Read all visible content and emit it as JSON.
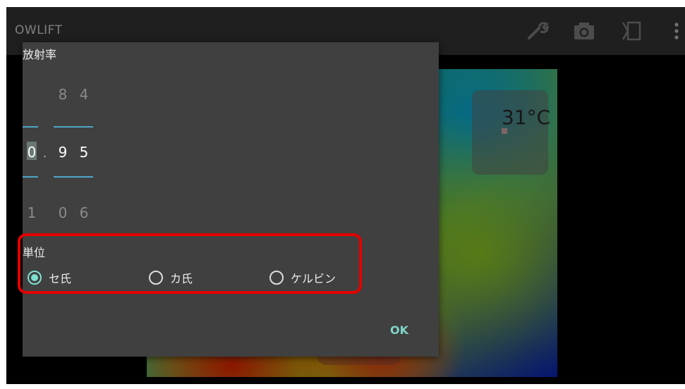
{
  "app": {
    "title": "OWLIFT"
  },
  "toolbar": {
    "icons": [
      "wrench-icon",
      "camera-icon",
      "screen-toggle-icon",
      "overflow-menu-icon"
    ]
  },
  "thermal": {
    "temperature_readout": "31°C"
  },
  "dialog": {
    "title": "放射率",
    "emissivity": {
      "integer": {
        "prev": "",
        "current": "0",
        "next": "1"
      },
      "tenths": {
        "prev": "8",
        "current": "9",
        "next": "0"
      },
      "hundredths": {
        "prev": "4",
        "current": "5",
        "next": "6"
      }
    },
    "unit_label": "単位",
    "units": [
      {
        "label": "セ氏",
        "checked": true
      },
      {
        "label": "カ氏",
        "checked": false
      },
      {
        "label": "ケルビン",
        "checked": false
      }
    ],
    "ok_label": "OK"
  },
  "colors": {
    "accent": "#7fe0d0",
    "picker_line": "#4fa6c9",
    "highlight_border": "#e50000",
    "dialog_bg": "#404040",
    "actionbar_bg": "#3a3a3a"
  }
}
